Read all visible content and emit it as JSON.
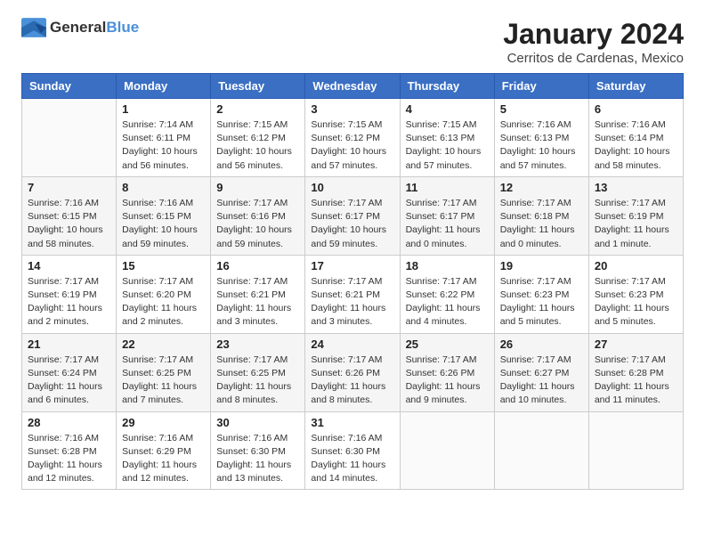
{
  "logo": {
    "general": "General",
    "blue": "Blue"
  },
  "header": {
    "month": "January 2024",
    "location": "Cerritos de Cardenas, Mexico"
  },
  "days_of_week": [
    "Sunday",
    "Monday",
    "Tuesday",
    "Wednesday",
    "Thursday",
    "Friday",
    "Saturday"
  ],
  "weeks": [
    [
      {
        "day": "",
        "info": ""
      },
      {
        "day": "1",
        "info": "Sunrise: 7:14 AM\nSunset: 6:11 PM\nDaylight: 10 hours\nand 56 minutes."
      },
      {
        "day": "2",
        "info": "Sunrise: 7:15 AM\nSunset: 6:12 PM\nDaylight: 10 hours\nand 56 minutes."
      },
      {
        "day": "3",
        "info": "Sunrise: 7:15 AM\nSunset: 6:12 PM\nDaylight: 10 hours\nand 57 minutes."
      },
      {
        "day": "4",
        "info": "Sunrise: 7:15 AM\nSunset: 6:13 PM\nDaylight: 10 hours\nand 57 minutes."
      },
      {
        "day": "5",
        "info": "Sunrise: 7:16 AM\nSunset: 6:13 PM\nDaylight: 10 hours\nand 57 minutes."
      },
      {
        "day": "6",
        "info": "Sunrise: 7:16 AM\nSunset: 6:14 PM\nDaylight: 10 hours\nand 58 minutes."
      }
    ],
    [
      {
        "day": "7",
        "info": "Sunrise: 7:16 AM\nSunset: 6:15 PM\nDaylight: 10 hours\nand 58 minutes."
      },
      {
        "day": "8",
        "info": "Sunrise: 7:16 AM\nSunset: 6:15 PM\nDaylight: 10 hours\nand 59 minutes."
      },
      {
        "day": "9",
        "info": "Sunrise: 7:17 AM\nSunset: 6:16 PM\nDaylight: 10 hours\nand 59 minutes."
      },
      {
        "day": "10",
        "info": "Sunrise: 7:17 AM\nSunset: 6:17 PM\nDaylight: 10 hours\nand 59 minutes."
      },
      {
        "day": "11",
        "info": "Sunrise: 7:17 AM\nSunset: 6:17 PM\nDaylight: 11 hours\nand 0 minutes."
      },
      {
        "day": "12",
        "info": "Sunrise: 7:17 AM\nSunset: 6:18 PM\nDaylight: 11 hours\nand 0 minutes."
      },
      {
        "day": "13",
        "info": "Sunrise: 7:17 AM\nSunset: 6:19 PM\nDaylight: 11 hours\nand 1 minute."
      }
    ],
    [
      {
        "day": "14",
        "info": "Sunrise: 7:17 AM\nSunset: 6:19 PM\nDaylight: 11 hours\nand 2 minutes."
      },
      {
        "day": "15",
        "info": "Sunrise: 7:17 AM\nSunset: 6:20 PM\nDaylight: 11 hours\nand 2 minutes."
      },
      {
        "day": "16",
        "info": "Sunrise: 7:17 AM\nSunset: 6:21 PM\nDaylight: 11 hours\nand 3 minutes."
      },
      {
        "day": "17",
        "info": "Sunrise: 7:17 AM\nSunset: 6:21 PM\nDaylight: 11 hours\nand 3 minutes."
      },
      {
        "day": "18",
        "info": "Sunrise: 7:17 AM\nSunset: 6:22 PM\nDaylight: 11 hours\nand 4 minutes."
      },
      {
        "day": "19",
        "info": "Sunrise: 7:17 AM\nSunset: 6:23 PM\nDaylight: 11 hours\nand 5 minutes."
      },
      {
        "day": "20",
        "info": "Sunrise: 7:17 AM\nSunset: 6:23 PM\nDaylight: 11 hours\nand 5 minutes."
      }
    ],
    [
      {
        "day": "21",
        "info": "Sunrise: 7:17 AM\nSunset: 6:24 PM\nDaylight: 11 hours\nand 6 minutes."
      },
      {
        "day": "22",
        "info": "Sunrise: 7:17 AM\nSunset: 6:25 PM\nDaylight: 11 hours\nand 7 minutes."
      },
      {
        "day": "23",
        "info": "Sunrise: 7:17 AM\nSunset: 6:25 PM\nDaylight: 11 hours\nand 8 minutes."
      },
      {
        "day": "24",
        "info": "Sunrise: 7:17 AM\nSunset: 6:26 PM\nDaylight: 11 hours\nand 8 minutes."
      },
      {
        "day": "25",
        "info": "Sunrise: 7:17 AM\nSunset: 6:26 PM\nDaylight: 11 hours\nand 9 minutes."
      },
      {
        "day": "26",
        "info": "Sunrise: 7:17 AM\nSunset: 6:27 PM\nDaylight: 11 hours\nand 10 minutes."
      },
      {
        "day": "27",
        "info": "Sunrise: 7:17 AM\nSunset: 6:28 PM\nDaylight: 11 hours\nand 11 minutes."
      }
    ],
    [
      {
        "day": "28",
        "info": "Sunrise: 7:16 AM\nSunset: 6:28 PM\nDaylight: 11 hours\nand 12 minutes."
      },
      {
        "day": "29",
        "info": "Sunrise: 7:16 AM\nSunset: 6:29 PM\nDaylight: 11 hours\nand 12 minutes."
      },
      {
        "day": "30",
        "info": "Sunrise: 7:16 AM\nSunset: 6:30 PM\nDaylight: 11 hours\nand 13 minutes."
      },
      {
        "day": "31",
        "info": "Sunrise: 7:16 AM\nSunset: 6:30 PM\nDaylight: 11 hours\nand 14 minutes."
      },
      {
        "day": "",
        "info": ""
      },
      {
        "day": "",
        "info": ""
      },
      {
        "day": "",
        "info": ""
      }
    ]
  ]
}
